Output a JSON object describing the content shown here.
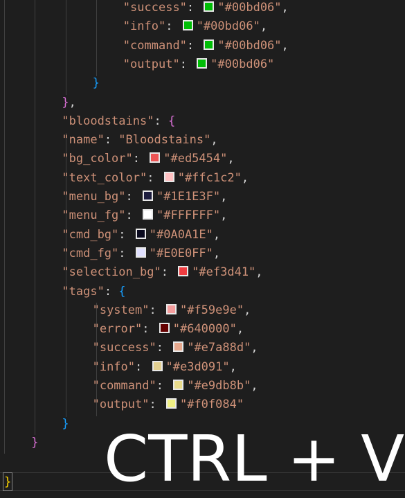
{
  "editor": {
    "lines": [
      {
        "indent": 16,
        "key": "\"success\"",
        "swatch": "#00bd06",
        "value": "\"#00bd06\"",
        "trail": ","
      },
      {
        "indent": 16,
        "key": "\"info\"",
        "swatch": "#00bd06",
        "value": "\"#00bd06\"",
        "trail": ","
      },
      {
        "indent": 16,
        "key": "\"command\"",
        "swatch": "#00bd06",
        "value": "\"#00bd06\"",
        "trail": ","
      },
      {
        "indent": 16,
        "key": "\"output\"",
        "swatch": "#00bd06",
        "value": "\"#00bd06\"",
        "trail": ""
      },
      {
        "indent": 12,
        "bracket": "}",
        "bracketClass": "br3",
        "trail": ""
      },
      {
        "indent": 8,
        "bracket": "}",
        "bracketClass": "br2",
        "trail": ","
      },
      {
        "indent": 8,
        "key": "\"bloodstains\"",
        "bracket": "{",
        "bracketClass": "br2",
        "trail": ""
      },
      {
        "indent": 8,
        "key": "\"name\"",
        "value": "\"Bloodstains\"",
        "trail": ","
      },
      {
        "indent": 8,
        "key": "\"bg_color\"",
        "swatch": "#ed5454",
        "value": "\"#ed5454\"",
        "trail": ","
      },
      {
        "indent": 8,
        "key": "\"text_color\"",
        "swatch": "#ffc1c2",
        "value": "\"#ffc1c2\"",
        "trail": ","
      },
      {
        "indent": 8,
        "key": "\"menu_bg\"",
        "swatch": "#1E1E3F",
        "value": "\"#1E1E3F\"",
        "trail": ","
      },
      {
        "indent": 8,
        "key": "\"menu_fg\"",
        "swatch": "#FFFFFF",
        "value": "\"#FFFFFF\"",
        "trail": ","
      },
      {
        "indent": 8,
        "key": "\"cmd_bg\"",
        "swatch": "#0A0A1E",
        "value": "\"#0A0A1E\"",
        "trail": ","
      },
      {
        "indent": 8,
        "key": "\"cmd_fg\"",
        "swatch": "#E0E0FF",
        "value": "\"#E0E0FF\"",
        "trail": ","
      },
      {
        "indent": 8,
        "key": "\"selection_bg\"",
        "swatch": "#ef3d41",
        "value": "\"#ef3d41\"",
        "trail": ","
      },
      {
        "indent": 8,
        "key": "\"tags\"",
        "bracket": "{",
        "bracketClass": "br3",
        "trail": ""
      },
      {
        "indent": 12,
        "key": "\"system\"",
        "swatch": "#f59e9e",
        "value": "\"#f59e9e\"",
        "trail": ","
      },
      {
        "indent": 12,
        "key": "\"error\"",
        "swatch": "#640000",
        "value": "\"#640000\"",
        "trail": ","
      },
      {
        "indent": 12,
        "key": "\"success\"",
        "swatch": "#e7a88d",
        "value": "\"#e7a88d\"",
        "trail": ","
      },
      {
        "indent": 12,
        "key": "\"info\"",
        "swatch": "#e3d091",
        "value": "\"#e3d091\"",
        "trail": ","
      },
      {
        "indent": 12,
        "key": "\"command\"",
        "swatch": "#e9db8b",
        "value": "\"#e9db8b\"",
        "trail": ","
      },
      {
        "indent": 12,
        "key": "\"output\"",
        "swatch": "#f0f084",
        "value": "\"#f0f084\"",
        "trail": ""
      },
      {
        "indent": 8,
        "bracket": "}",
        "bracketClass": "br3",
        "trail": ""
      },
      {
        "indent": 4,
        "bracket": "}",
        "bracketClass": "br2",
        "trail": ""
      }
    ],
    "cursor_line_text": "}"
  },
  "overlay": {
    "text": "CTRL + V"
  },
  "colors": {
    "background": "#1e1e1e",
    "string": "#ce9178",
    "bracket_gold": "#ffd700",
    "bracket_purple": "#da70d6",
    "bracket_blue": "#179fff"
  }
}
